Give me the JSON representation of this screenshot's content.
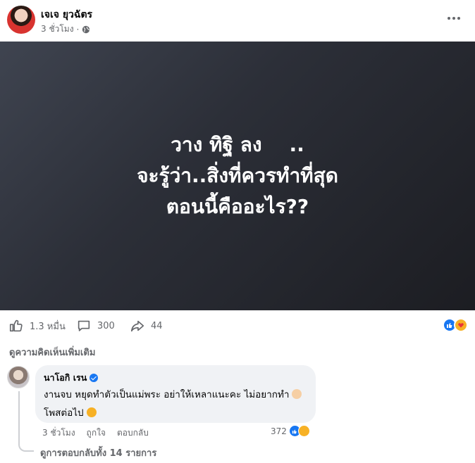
{
  "post": {
    "author": "เจเจ ยุวฉัตร",
    "time": "3 ชั่วโมง",
    "separator": "·",
    "privacy_icon": "globe-icon",
    "image_text": [
      "วาง ทิฐิ ลง    ..",
      "จะรู้ว่า..สิ่งที่ควรทำที่สุด",
      "ตอนนี้คืออะไร??"
    ]
  },
  "stats": {
    "likes": "1.3 หมื่น",
    "comments": "300",
    "shares": "44",
    "reaction_icons": [
      "like-icon",
      "care-icon"
    ]
  },
  "comments_section": {
    "more_comments_label": "ดูความคิดเห็นเพิ่มเติม",
    "comment": {
      "name": "นาโอกิ เรน",
      "verified": true,
      "line1": "งานจบ หยุดทำตัวเป็นแม่พระ อย่าให้เหลาแนะคะ ไม่อยากทำ",
      "line2": "โพสต่อไป",
      "time": "3 ชั่วโมง",
      "like_label": "ถูกใจ",
      "reply_label": "ตอบกลับ",
      "reaction_count": "372",
      "reaction_icons": [
        "like-icon",
        "haha-icon"
      ]
    },
    "view_replies_label": "ดูการตอบกลับทั้ง 14 รายการ"
  },
  "colors": {
    "accent": "#1877f2",
    "secondary_text": "#65676b",
    "bubble_bg": "#f0f2f5"
  }
}
